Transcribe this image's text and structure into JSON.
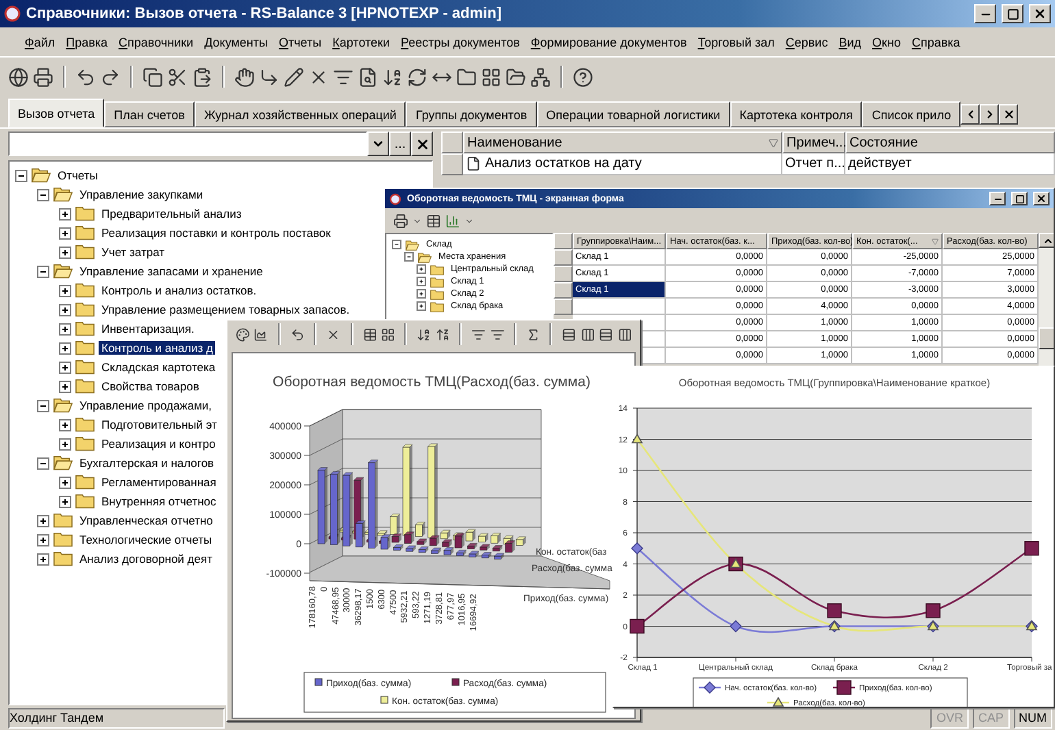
{
  "window": {
    "title": "Справочники: Вызов отчета - RS-Balance 3 [HPNOTEXP - admin]"
  },
  "menu": [
    "Файл",
    "Правка",
    "Справочники",
    "Документы",
    "Отчеты",
    "Картотеки",
    "Реестры документов",
    "Формирование документов",
    "Торговый зал",
    "Сервис",
    "Вид",
    "Окно",
    "Справка"
  ],
  "tabs": [
    {
      "label": "Вызов отчета",
      "selected": true
    },
    {
      "label": "План счетов",
      "selected": false
    },
    {
      "label": "Журнал хозяйственных операций",
      "selected": false
    },
    {
      "label": "Группы документов",
      "selected": false
    },
    {
      "label": "Операции товарной логистики",
      "selected": false
    },
    {
      "label": "Картотека контроля",
      "selected": false
    },
    {
      "label": "Список прило",
      "selected": false
    }
  ],
  "filter": {
    "browse_label": "..."
  },
  "tree": [
    {
      "label": "Отчеты",
      "expanded": true,
      "selected": false,
      "children": [
        {
          "label": "Управление закупками",
          "expanded": true,
          "selected": false,
          "children": [
            {
              "label": "Предварительный анализ",
              "expanded": false,
              "selected": false
            },
            {
              "label": "Реализация поставки и контроль поставок",
              "expanded": false,
              "selected": false
            },
            {
              "label": "Учет затрат",
              "expanded": false,
              "selected": false
            }
          ]
        },
        {
          "label": "Управление запасами и хранение",
          "expanded": true,
          "selected": false,
          "children": [
            {
              "label": "Контроль и анализ остатков.",
              "expanded": false,
              "selected": false
            },
            {
              "label": "Управление размещением товарных запасов.",
              "expanded": false,
              "selected": false
            },
            {
              "label": "Инвентаризация.",
              "expanded": false,
              "selected": false
            },
            {
              "label": "Контроль и анализ д",
              "expanded": false,
              "selected": true
            },
            {
              "label": "Складская картотека",
              "expanded": false,
              "selected": false
            },
            {
              "label": "Свойства товаров",
              "expanded": false,
              "selected": false
            }
          ]
        },
        {
          "label": "Управление продажами,",
          "expanded": true,
          "selected": false,
          "children": [
            {
              "label": "Подготовительный эт",
              "expanded": false,
              "selected": false
            },
            {
              "label": "Реализация и контро",
              "expanded": false,
              "selected": false
            }
          ]
        },
        {
          "label": "Бухгалтерская и налогов",
          "expanded": true,
          "selected": false,
          "children": [
            {
              "label": "Регламентированная",
              "expanded": false,
              "selected": false
            },
            {
              "label": "Внутренняя отчетнос",
              "expanded": false,
              "selected": false
            }
          ]
        },
        {
          "label": "Управленческая отчетно",
          "expanded": false,
          "selected": false
        },
        {
          "label": "Технологические отчеты",
          "expanded": false,
          "selected": false
        },
        {
          "label": "Анализ договорной деят",
          "expanded": false,
          "selected": false
        }
      ]
    }
  ],
  "report_list": {
    "columns": [
      "Наименование",
      "Примеч...",
      "Состояние"
    ],
    "rows": [
      [
        "Анализ остатков на дату",
        "Отчет п...",
        "действует"
      ]
    ]
  },
  "turnover_form": {
    "title": "Оборотная ведомость ТМЦ - экранная форма",
    "tree": [
      {
        "label": "Склад",
        "expanded": true,
        "children": [
          {
            "label": "Места хранения",
            "expanded": true,
            "children": [
              {
                "label": "Центральный склад",
                "expanded": false
              },
              {
                "label": "Склад 1",
                "expanded": false
              },
              {
                "label": "Склад 2",
                "expanded": false
              },
              {
                "label": "Склад брака",
                "expanded": false
              }
            ]
          }
        ]
      }
    ],
    "columns": [
      "Группировка\\Наим...",
      "Нач. остаток(баз. к...",
      "Приход(баз. кол-во)",
      "Кон. остаток(...",
      "Расход(баз. кол-во)"
    ],
    "rows": [
      {
        "cells": [
          "Склад 1",
          "0,0000",
          "0,0000",
          "-25,0000",
          "25,0000"
        ],
        "selected": false
      },
      {
        "cells": [
          "Склад 1",
          "0,0000",
          "0,0000",
          "-7,0000",
          "7,0000"
        ],
        "selected": false
      },
      {
        "cells": [
          "Склад 1",
          "0,0000",
          "0,0000",
          "-3,0000",
          "3,0000"
        ],
        "selected": true
      },
      {
        "cells": [
          "",
          "0,0000",
          "4,0000",
          "0,0000",
          "4,0000"
        ],
        "selected": false
      },
      {
        "cells": [
          "",
          "0,0000",
          "1,0000",
          "1,0000",
          "0,0000"
        ],
        "selected": false
      },
      {
        "cells": [
          "",
          "0,0000",
          "1,0000",
          "1,0000",
          "0,0000"
        ],
        "selected": false
      },
      {
        "cells": [
          "",
          "0,0000",
          "1,0000",
          "1,0000",
          "0,0000"
        ],
        "selected": false
      }
    ]
  },
  "amount_chart": {
    "title": "Оборотная ведомость ТМЦ(Расход(баз. сумма)",
    "y_labels": [
      "400000",
      "300000",
      "200000",
      "100000",
      "0",
      "-100000"
    ],
    "categories": [
      "178160,78",
      "0",
      "47468,95",
      "30000",
      "36298,17",
      "1500",
      "6300",
      "47500",
      "5932,21",
      "593,22",
      "1271,19",
      "3728,81",
      "677,97",
      "1016,95",
      "16694,92"
    ],
    "depth_labels": [
      "Кон. остаток(баз",
      "Расход(баз. сумма",
      "Приход(баз. сумма)"
    ],
    "legend": [
      {
        "name": "Приход(баз. сумма)",
        "color": "#6666cc"
      },
      {
        "name": "Расход(баз. сумма)",
        "color": "#7a1f4f"
      },
      {
        "name": "Кон. остаток(баз. сумма)",
        "color": "#eeee99"
      }
    ]
  },
  "quantity_chart": {
    "chart_data": {
      "type": "line",
      "title": "Оборотная ведомость ТМЦ(Группировка\\Наименование краткое)",
      "categories": [
        "Склад 1",
        "Центральный склад",
        "Склад брака",
        "Склад 2",
        "Торговый за"
      ],
      "ylim": [
        -2,
        14
      ],
      "yticks": [
        -2,
        0,
        2,
        4,
        6,
        8,
        10,
        12,
        14
      ],
      "grid": true,
      "legend": true,
      "series": [
        {
          "name": "Нач. остаток(баз. кол-во)",
          "color": "#7b7bd6",
          "marker": "diamond",
          "values": [
            5,
            0,
            0,
            0,
            0
          ]
        },
        {
          "name": "Приход(баз. кол-во)",
          "color": "#7a1f4f",
          "marker": "square",
          "values": [
            0,
            4,
            1,
            1,
            5
          ]
        },
        {
          "name": "Расход(баз. кол-во)",
          "color": "#e6e67a",
          "marker": "triangle",
          "values": [
            12,
            4,
            0,
            0,
            0
          ]
        }
      ]
    }
  },
  "status_bar": {
    "company": "Холдинг Тандем",
    "indicators": [
      {
        "label": "OVR",
        "on": false
      },
      {
        "label": "CAP",
        "on": false
      },
      {
        "label": "NUM",
        "on": true
      }
    ]
  }
}
